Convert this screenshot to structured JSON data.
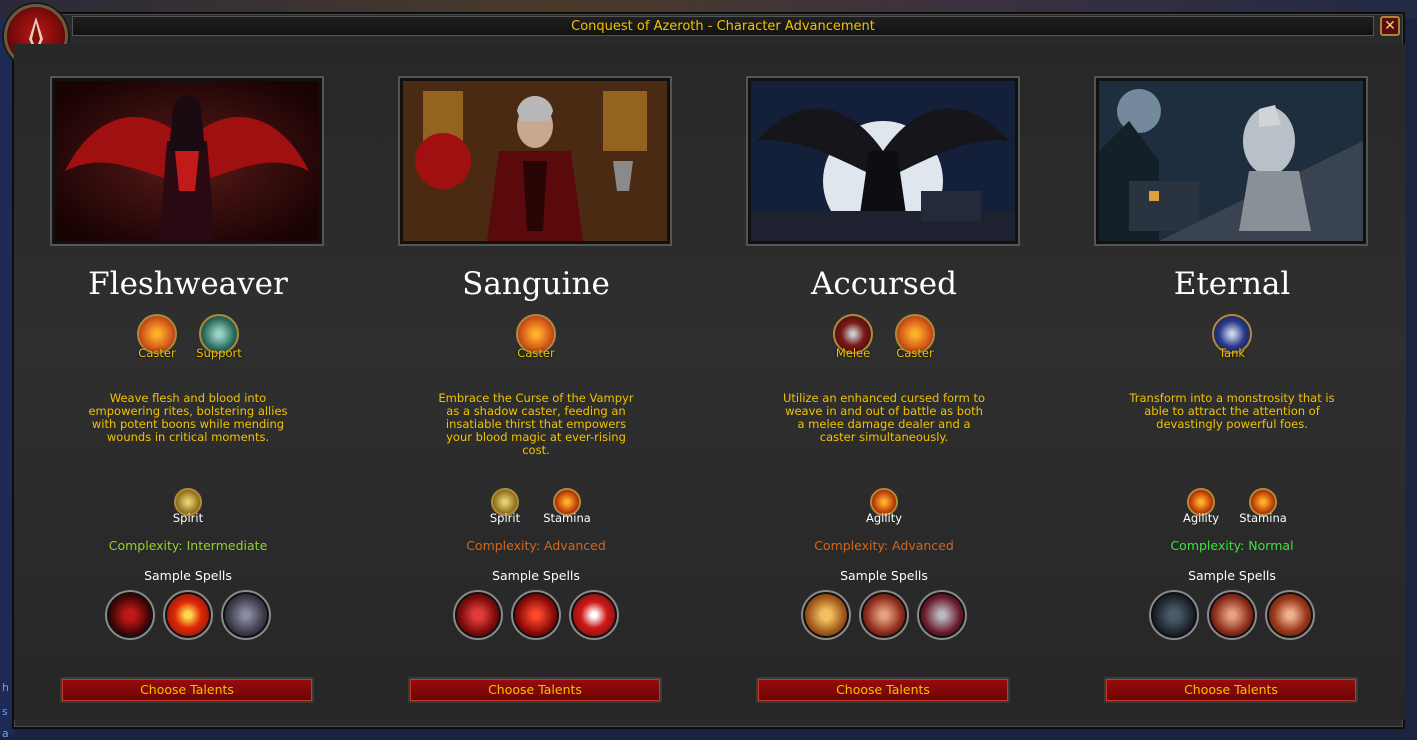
{
  "window": {
    "title": "Conquest of Azeroth - Character Advancement",
    "close_label": "✕"
  },
  "background_text": [
    "h",
    "s",
    "a"
  ],
  "classes": [
    {
      "name": "Fleshweaver",
      "roles": [
        {
          "label": "Caster",
          "icon": "caster-icon"
        },
        {
          "label": "Support",
          "icon": "support-icon"
        }
      ],
      "description": "Weave flesh and blood into empowering rites, bolstering allies with potent boons while mending wounds in critical moments.",
      "stats": [
        {
          "label": "Spirit",
          "icon": "spirit-icon"
        }
      ],
      "complexity": "Complexity: Intermediate",
      "complexity_color": "#8fd22a",
      "sample_spells_label": "Sample Spells",
      "spells": [
        "blood-vortex-icon",
        "blood-drop-icon",
        "shadow-wing-icon"
      ],
      "button": "Choose Talents"
    },
    {
      "name": "Sanguine",
      "roles": [
        {
          "label": "Caster",
          "icon": "caster-icon"
        }
      ],
      "description": "Embrace the Curse of the Vampyr as a shadow caster, feeding an insatiable thirst that empowers your blood magic at ever-rising cost.",
      "stats": [
        {
          "label": "Spirit",
          "icon": "spirit-icon"
        },
        {
          "label": "Stamina",
          "icon": "stamina-icon"
        }
      ],
      "complexity": "Complexity: Advanced",
      "complexity_color": "#d4661a",
      "sample_spells_label": "Sample Spells",
      "spells": [
        "blood-heart-icon",
        "demon-face-icon",
        "fanged-mouth-icon"
      ],
      "button": "Choose Talents"
    },
    {
      "name": "Accursed",
      "roles": [
        {
          "label": "Melee",
          "icon": "melee-icon"
        },
        {
          "label": "Caster",
          "icon": "caster-icon"
        }
      ],
      "description": "Utilize an enhanced cursed form to weave in and out of battle as both a melee damage dealer and a caster simultaneously.",
      "stats": [
        {
          "label": "Agility",
          "icon": "agility-icon"
        }
      ],
      "complexity": "Complexity: Advanced",
      "complexity_color": "#d4661a",
      "sample_spells_label": "Sample Spells",
      "spells": [
        "skull-icon",
        "claw-strike-icon",
        "vampire-face-icon"
      ],
      "button": "Choose Talents"
    },
    {
      "name": "Eternal",
      "roles": [
        {
          "label": "Tank",
          "icon": "tank-icon"
        }
      ],
      "description": "Transform into a monstrosity that is able to attract the attention of devastingly powerful foes.",
      "stats": [
        {
          "label": "Agility",
          "icon": "agility-icon"
        },
        {
          "label": "Stamina",
          "icon": "stamina-icon"
        }
      ],
      "complexity": "Complexity: Normal",
      "complexity_color": "#3ee23a",
      "sample_spells_label": "Sample Spells",
      "spells": [
        "wolf-head-icon",
        "claw-strike-icon",
        "rend-icon"
      ],
      "button": "Choose Talents"
    }
  ]
}
